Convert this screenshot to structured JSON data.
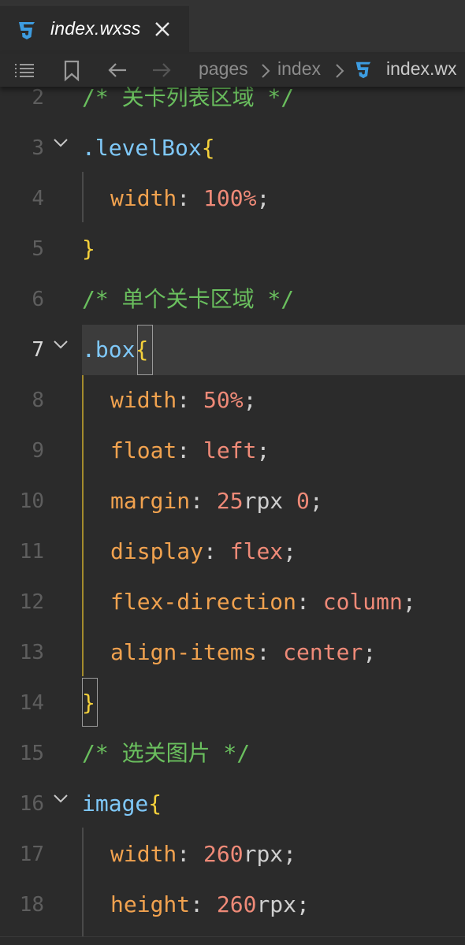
{
  "tab": {
    "title": "index.wxss",
    "icon": "css3-icon"
  },
  "breadcrumb": {
    "items": [
      "pages",
      "index"
    ],
    "file": "index.wx"
  },
  "colors": {
    "comment": "#6abf5e",
    "selector": "#7fc8f8",
    "brace": "#f5d13b",
    "property": "#f1a24f",
    "value": "#ef8a78",
    "css_icon": "#3d9ce0"
  },
  "lines": [
    {
      "num": "2",
      "comment": "/* 关卡列表区域 */"
    },
    {
      "num": "3",
      "selector": ".levelBox",
      "brace": "{"
    },
    {
      "num": "4",
      "prop": "width",
      "value": "100%"
    },
    {
      "num": "5",
      "brace": "}"
    },
    {
      "num": "6",
      "comment": "/* 单个关卡区域 */"
    },
    {
      "num": "7",
      "selector": ".box",
      "brace": "{"
    },
    {
      "num": "8",
      "prop": "width",
      "value": "50%"
    },
    {
      "num": "9",
      "prop": "float",
      "value": "left"
    },
    {
      "num": "10",
      "prop": "margin",
      "num_value": "25",
      "unit": "rpx",
      "value2": "0"
    },
    {
      "num": "11",
      "prop": "display",
      "value": "flex"
    },
    {
      "num": "12",
      "prop": "flex-direction",
      "value": "column"
    },
    {
      "num": "13",
      "prop": "align-items",
      "value": "center"
    },
    {
      "num": "14",
      "brace": "}"
    },
    {
      "num": "15",
      "comment": "/* 选关图片 */"
    },
    {
      "num": "16",
      "selector": "image",
      "brace": "{"
    },
    {
      "num": "17",
      "prop": "width",
      "num_value": "260",
      "unit": "rpx"
    },
    {
      "num": "18",
      "prop": "height",
      "num_value": "260",
      "unit": "rpx"
    }
  ],
  "punct": {
    "colon": ": ",
    "semi": ";",
    "space": " "
  }
}
